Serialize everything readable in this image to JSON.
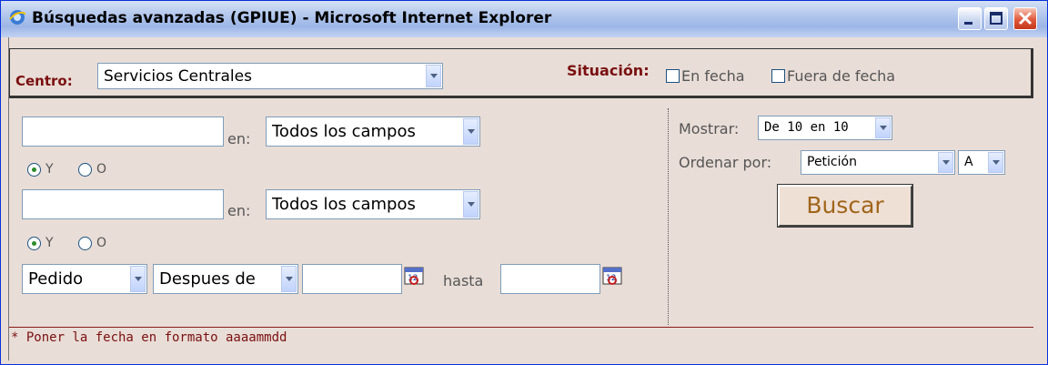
{
  "window": {
    "title": "Búsquedas avanzadas (GPIUE) - Microsoft Internet Explorer"
  },
  "top": {
    "centro_label": "Centro:",
    "centro_value": "Servicios Centrales",
    "situacion_label": "Situación:",
    "en_fecha_label": "En fecha",
    "fuera_de_fecha_label": "Fuera de fecha"
  },
  "search": {
    "row1": {
      "en_label": "en:",
      "field_value": "Todos los campos"
    },
    "op1": {
      "y_label": "Y",
      "o_label": "O",
      "selected": "Y"
    },
    "row2": {
      "en_label": "en:",
      "field_value": "Todos los campos"
    },
    "op2": {
      "y_label": "Y",
      "o_label": "O",
      "selected": "Y"
    },
    "date": {
      "field_value": "Pedido",
      "condition_value": "Despues de",
      "hasta_label": "hasta"
    }
  },
  "options": {
    "mostrar_label": "Mostrar:",
    "mostrar_value": "De 10 en 10",
    "ordenar_label": "Ordenar por:",
    "ordenar_value": "Petición",
    "direction_value": "A",
    "buscar_label": "Buscar"
  },
  "footnote": "* Poner la fecha en formato aaaammdd",
  "colors": {
    "accent_brown": "#7a1010",
    "button_text": "#a0651a",
    "background": "#e9ddd7"
  }
}
